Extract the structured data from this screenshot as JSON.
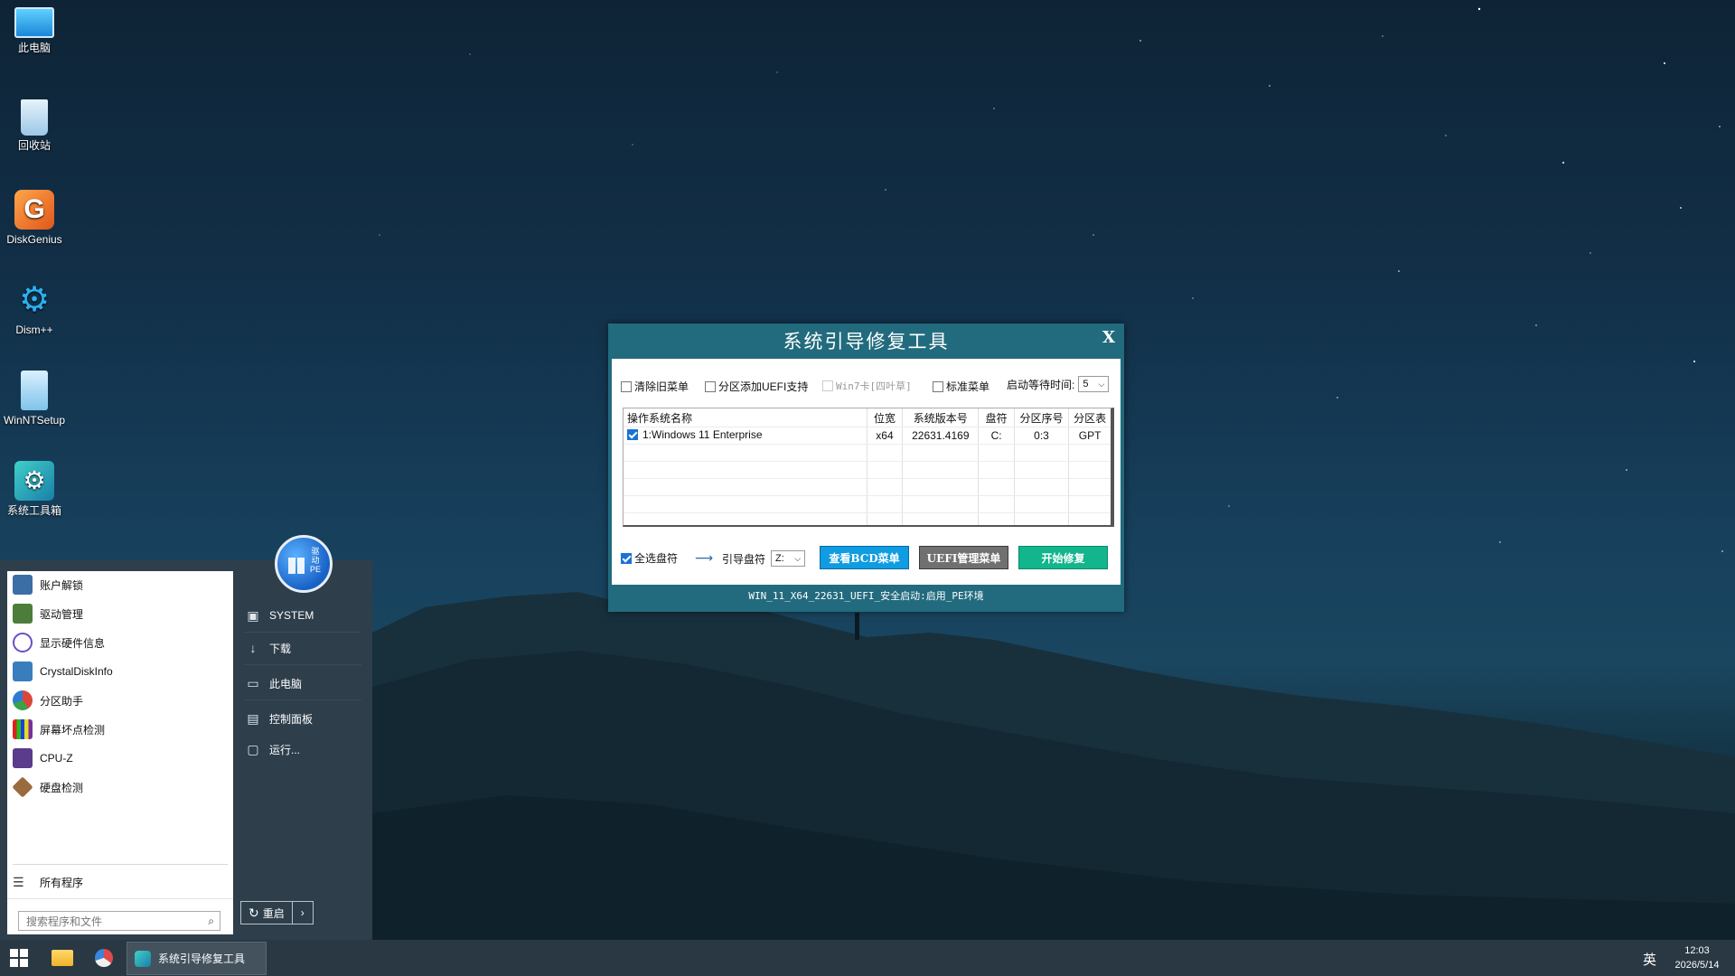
{
  "desktop": {
    "icons": [
      {
        "label": "此电脑",
        "icon": "monitor-icon"
      },
      {
        "label": "回收站",
        "icon": "recycle-bin-icon"
      },
      {
        "label": "DiskGenius",
        "icon": "diskgenius-icon"
      },
      {
        "label": "Dism++",
        "icon": "dism-gear-icon"
      },
      {
        "label": "WinNTSetup",
        "icon": "winntsetup-icon"
      },
      {
        "label": "系统工具箱",
        "icon": "toolbox-icon"
      }
    ]
  },
  "dialog": {
    "title": "系统引导修复工具",
    "close_label": "X",
    "options": {
      "clear_old_menu": {
        "label": "清除旧菜单",
        "checked": false
      },
      "uefi_support": {
        "label": "分区添加UEFI支持",
        "checked": false
      },
      "win7_card": {
        "label": "Win7卡[四叶草]",
        "checked": false,
        "disabled": true
      },
      "standard_menu": {
        "label": "标准菜单",
        "checked": false
      },
      "wait_time_label": "启动等待时间:",
      "wait_time_value": "5"
    },
    "table": {
      "headers": [
        "操作系统名称",
        "位宽",
        "系统版本号",
        "盘符",
        "分区序号",
        "分区表"
      ],
      "rows": [
        {
          "checked": true,
          "name": "1:Windows 11 Enterprise",
          "bits": "x64",
          "version": "22631.4169",
          "drive": "C:",
          "partition": "0:3",
          "table": "GPT"
        }
      ]
    },
    "select_all_label": "全选盘符",
    "select_all_checked": true,
    "boot_drive_label": "引导盘符",
    "boot_drive_value": "Z:",
    "buttons": {
      "view_bcd": "查看BCD菜单",
      "uefi_manage": "UEFI管理菜单",
      "start_repair": "开始修复"
    },
    "status": "WIN_11_X64_22631_UEFI_安全启动:启用_PE环境"
  },
  "start_menu": {
    "programs": [
      {
        "label": "账户解锁",
        "icon": "account-unlock-icon",
        "color": "#3b6ea5"
      },
      {
        "label": "驱动管理",
        "icon": "driver-manager-icon",
        "color": "#4d7d3a"
      },
      {
        "label": "显示硬件信息",
        "icon": "hardware-info-icon",
        "color": "#6a4fc2"
      },
      {
        "label": "CrystalDiskInfo",
        "icon": "crystaldiskinfo-icon",
        "color": "#3a7dbd"
      },
      {
        "label": "分区助手",
        "icon": "partition-assistant-icon",
        "color": "#d9473a"
      },
      {
        "label": "屏幕坏点检测",
        "icon": "screen-test-icon",
        "color": "#7b2f9c"
      },
      {
        "label": "CPU-Z",
        "icon": "cpuz-icon",
        "color": "#5a3b8c"
      },
      {
        "label": "硬盘检测",
        "icon": "disk-check-icon",
        "color": "#9a6b3c"
      }
    ],
    "all_programs": "所有程序",
    "search_placeholder": "搜索程序和文件",
    "avatar_text": "驱动\nPE",
    "right_items": [
      {
        "label": "SYSTEM",
        "icon": "user-folder-icon"
      },
      {
        "label": "下载",
        "icon": "download-icon"
      },
      {
        "label": "此电脑",
        "icon": "computer-icon"
      },
      {
        "label": "控制面板",
        "icon": "control-panel-icon"
      },
      {
        "label": "运行...",
        "icon": "run-icon"
      }
    ],
    "restart_label": "重启"
  },
  "taskbar": {
    "active_app": "系统引导修复工具",
    "ime": "英",
    "time": "12:03",
    "date": "2026/5/14"
  }
}
